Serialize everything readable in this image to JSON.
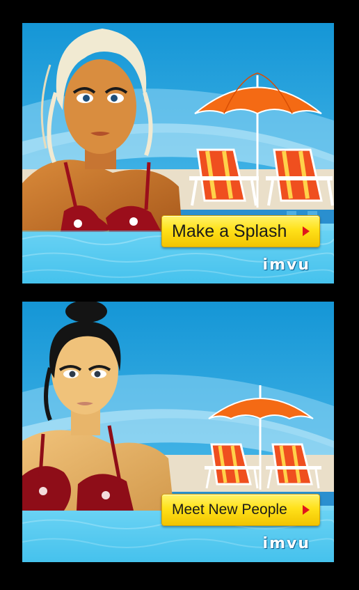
{
  "ads": [
    {
      "cta_label": "Make a Splash",
      "logo": "imvu"
    },
    {
      "cta_label": "Meet New People",
      "logo": "imvu"
    }
  ],
  "colors": {
    "page_background": "#000000",
    "sky": "#1b9bd8",
    "water": "#4fc6ee",
    "umbrella": "#f46a14",
    "cta_yellow": "#ffe11a",
    "cta_arrow": "#e0151b"
  },
  "icons": {
    "cta_arrow": "play-arrow-icon",
    "umbrella": "beach-umbrella-icon",
    "chair": "deck-chair-icon"
  }
}
